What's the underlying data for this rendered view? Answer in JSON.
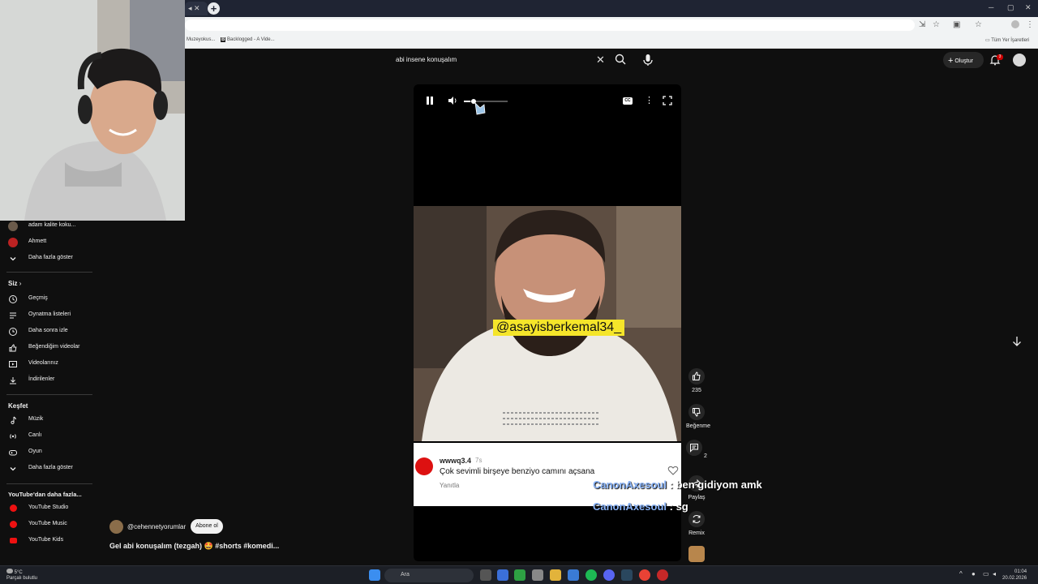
{
  "browser": {
    "bookmarks": [
      "Muzeyokus...",
      "Backlogged - A Vide...",
      "Tüm Yer İşaretleri"
    ]
  },
  "header": {
    "search_value": "abi insene konuşalım",
    "create_label": "Oluştur",
    "notification_count": "3"
  },
  "sidebar": {
    "top_items": [
      {
        "label": "adam kalite koku...",
        "icon": "channel-avatar"
      },
      {
        "label": "Ahmett",
        "icon": "channel-avatar"
      },
      {
        "label": "Daha fazla göster",
        "icon": "chevron-down-icon"
      }
    ],
    "you_heading": "Siz",
    "you_items": [
      {
        "label": "Geçmiş",
        "icon": "history-icon"
      },
      {
        "label": "Oynatma listeleri",
        "icon": "playlist-icon"
      },
      {
        "label": "Daha sonra izle",
        "icon": "clock-icon"
      },
      {
        "label": "Beğendiğim videolar",
        "icon": "thumbs-up-icon"
      },
      {
        "label": "Videolarınız",
        "icon": "video-icon"
      },
      {
        "label": "İndirilenler",
        "icon": "download-icon"
      }
    ],
    "explore_heading": "Keşfet",
    "explore_items": [
      {
        "label": "Müzik",
        "icon": "music-icon"
      },
      {
        "label": "Canlı",
        "icon": "live-icon"
      },
      {
        "label": "Oyun",
        "icon": "gaming-icon"
      },
      {
        "label": "Daha fazla göster",
        "icon": "chevron-down-icon"
      }
    ],
    "more_heading": "YouTube'dan daha fazla...",
    "more_items": [
      {
        "label": "YouTube Studio",
        "icon": "youtube-studio-icon"
      },
      {
        "label": "YouTube Music",
        "icon": "youtube-music-icon"
      },
      {
        "label": "YouTube Kids",
        "icon": "youtube-kids-icon"
      }
    ]
  },
  "video": {
    "overlay_handle": "@asayisberkemal34_",
    "comment": {
      "user": "wwwq3.4",
      "age": "7s",
      "text": "Çok sevimli birşeye benziyo camını açsana",
      "reply": "Yanıtla"
    },
    "volume_level": 0.15
  },
  "actions": {
    "like_count": "235",
    "dislike_label": "Beğenme",
    "comment_count": "2",
    "share_label": "Paylaş",
    "remix_label": "Remix"
  },
  "chat": [
    {
      "user": "CanonAxesoul",
      "message": "ben gidiyom amk"
    },
    {
      "user": "CanonAxesoul",
      "message": "sg"
    }
  ],
  "short_info": {
    "channel": "@cehennetyorumlar",
    "subscribe_label": "Abone ol",
    "title": "Gel abi konuşalım (tezgah) 🤩 #shorts #komedi..."
  },
  "taskbar": {
    "temperature": "5°C",
    "weather": "Parçalı bulutlu",
    "search_placeholder": "Ara",
    "time": "01:04",
    "date": "20.02.2026"
  },
  "colors": {
    "background": "#0f0f0f",
    "accent_red": "#cc0000",
    "chat_user": "#8ab4f8",
    "handle_tag": "#f5e52a"
  }
}
